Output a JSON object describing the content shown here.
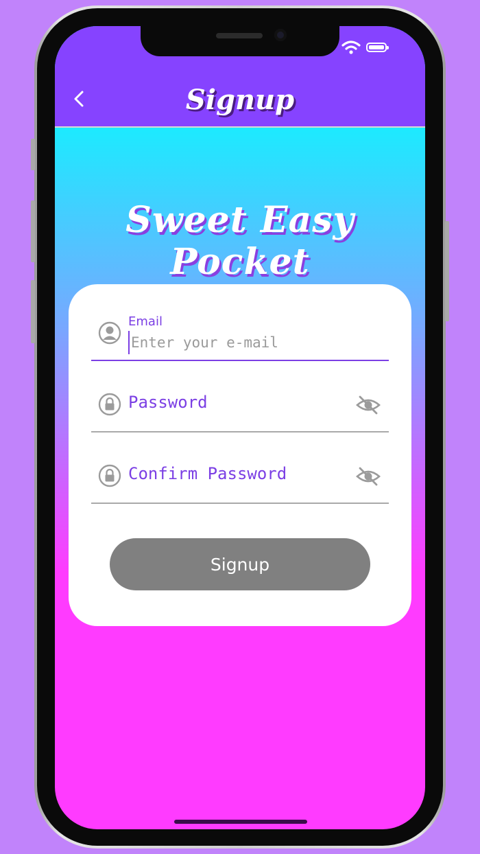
{
  "nav": {
    "title": "Signup",
    "back_icon": "chevron-left-icon"
  },
  "status_bar": {
    "wifi_icon": "wifi-icon",
    "battery_icon": "battery-icon"
  },
  "app": {
    "title": "Sweet Easy Pocket"
  },
  "form": {
    "email": {
      "label": "Email",
      "placeholder": "Enter your e-mail",
      "value": ""
    },
    "password": {
      "label": "Password",
      "value": ""
    },
    "confirm_password": {
      "label": "Confirm Password",
      "value": ""
    },
    "submit_label": "Signup"
  },
  "colors": {
    "accent": "#8643ff",
    "label": "#7b3fe4",
    "button": "#808080",
    "gradient_top": "#00ffff",
    "gradient_bottom": "#ff3bff"
  }
}
